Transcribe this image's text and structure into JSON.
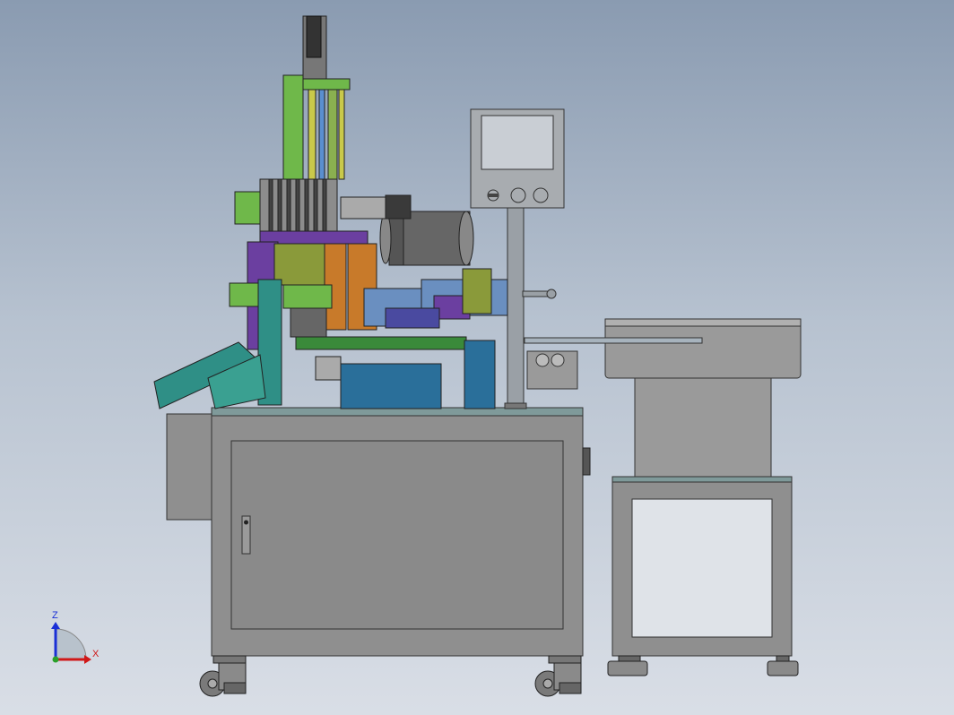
{
  "triad": {
    "z_label": "Z",
    "x_label": "X",
    "z_color": "#1a2fd6",
    "x_color": "#d01818",
    "origin_color": "#2aa02a"
  },
  "colors": {
    "cabinet": "#8f8f8f",
    "cabinet_dark": "#6e6e6e",
    "top_plate": "#7f9a9a",
    "feeder_bowl": "#9a9a9a",
    "monitor_frame": "#a8acb0",
    "monitor_screen": "#c9ced4",
    "green_part": "#6fb84a",
    "teal_part": "#2f8f86",
    "purple_part": "#6b3fa0",
    "orange_part": "#c87a2a",
    "blue_block": "#2a6f9a",
    "olive_part": "#8a9a3a"
  }
}
